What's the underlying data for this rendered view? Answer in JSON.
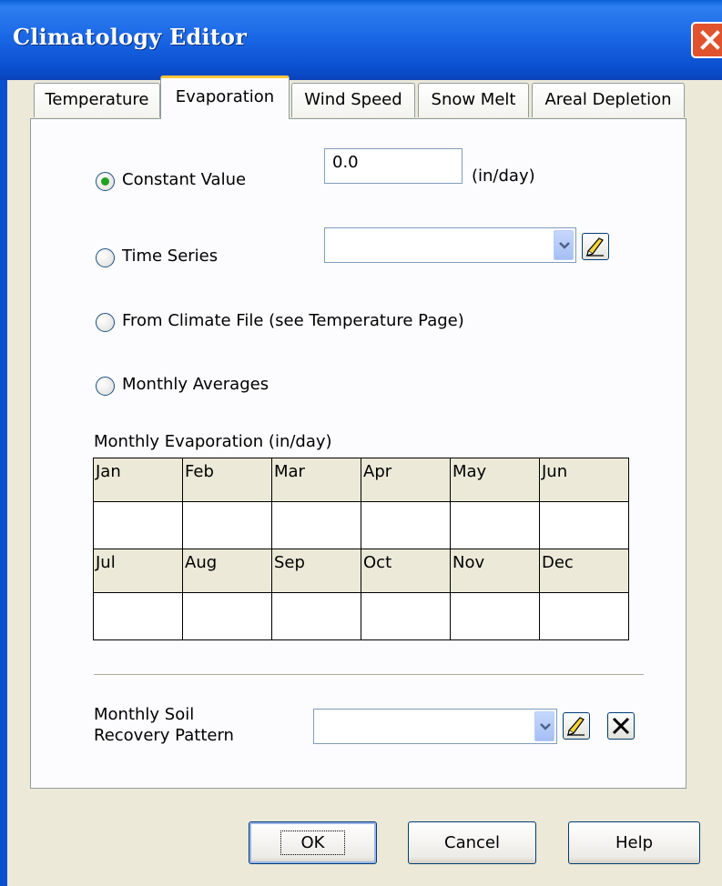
{
  "window": {
    "title": "Climatology Editor"
  },
  "tabs": [
    {
      "label": "Temperature"
    },
    {
      "label": "Evaporation"
    },
    {
      "label": "Wind Speed"
    },
    {
      "label": "Snow Melt"
    },
    {
      "label": "Areal Depletion"
    }
  ],
  "active_tab": "Evaporation",
  "options": {
    "constant_value": {
      "label": "Constant Value",
      "selected": true,
      "value": "0.0",
      "units": "(in/day)"
    },
    "time_series": {
      "label": "Time Series",
      "selected": false,
      "value": ""
    },
    "climate_file": {
      "label": "From Climate File (see Temperature Page)",
      "selected": false
    },
    "monthly_averages": {
      "label": "Monthly Averages",
      "selected": false
    }
  },
  "monthly_table": {
    "label": "Monthly Evaporation (in/day)",
    "row1": [
      "Jan",
      "Feb",
      "Mar",
      "Apr",
      "May",
      "Jun"
    ],
    "row2": [
      "Jul",
      "Aug",
      "Sep",
      "Oct",
      "Nov",
      "Dec"
    ],
    "values1": [
      "",
      "",
      "",
      "",
      "",
      ""
    ],
    "values2": [
      "",
      "",
      "",
      "",
      "",
      ""
    ]
  },
  "soil_recovery": {
    "label_line1": "Monthly Soil",
    "label_line2": "Recovery Pattern",
    "value": ""
  },
  "buttons": {
    "ok": "OK",
    "cancel": "Cancel",
    "help": "Help"
  },
  "icons": {
    "close": "close-icon",
    "edit": "edit-pencil-icon",
    "delete": "delete-x-icon",
    "dropdown": "chevron-down-icon"
  },
  "colors": {
    "titlebar": "#0a5fd8",
    "dialog_bg": "#ece9d8",
    "active_tab_accent": "#ffc83c",
    "radio_dot": "#21a121",
    "close_button": "#e1532d"
  }
}
